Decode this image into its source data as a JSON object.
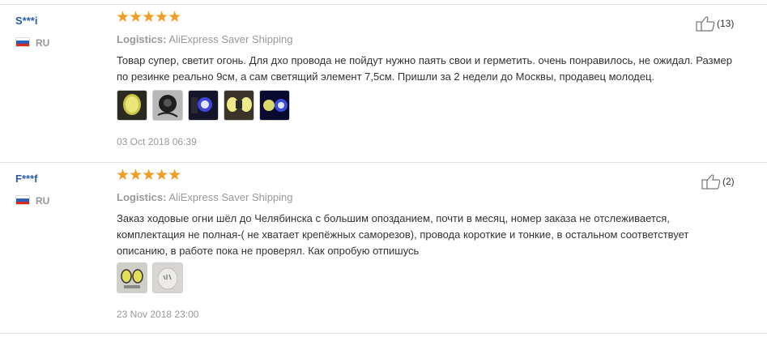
{
  "reviews": [
    {
      "user": "S***i",
      "country": "RU",
      "rating": "★★★★★",
      "logistics_label": "Logistics:",
      "logistics_value": "AliExpress Saver Shipping",
      "text": "Товар супер, светит огонь. Для дхо провода не пойдут нужно паять свои и герметить. очень понравилось, не ожидал. Размер по резинке реально 9см, а сам светящий элемент 7,5см. Пришли за 2 недели до Москвы, продавец молодец.",
      "date": "03 Oct 2018 06:39",
      "helpful_count": "(13)",
      "photo_count": 5
    },
    {
      "user": "F***f",
      "country": "RU",
      "rating": "★★★★★",
      "logistics_label": "Logistics:",
      "logistics_value": "AliExpress Saver Shipping",
      "text": "Заказ ходовые огни шёл до Челябинска с большим опозданием, почти в месяц, номер заказа не отслеживается, комплектация не полная-( не хватает крепёжных саморезов), провода короткие и тонкие, в остальном соответствует описанию, в работе пока не проверял. Как опробую отпишусь",
      "date": "23 Nov 2018 23:00",
      "helpful_count": "(2)",
      "photo_count": 2
    }
  ]
}
